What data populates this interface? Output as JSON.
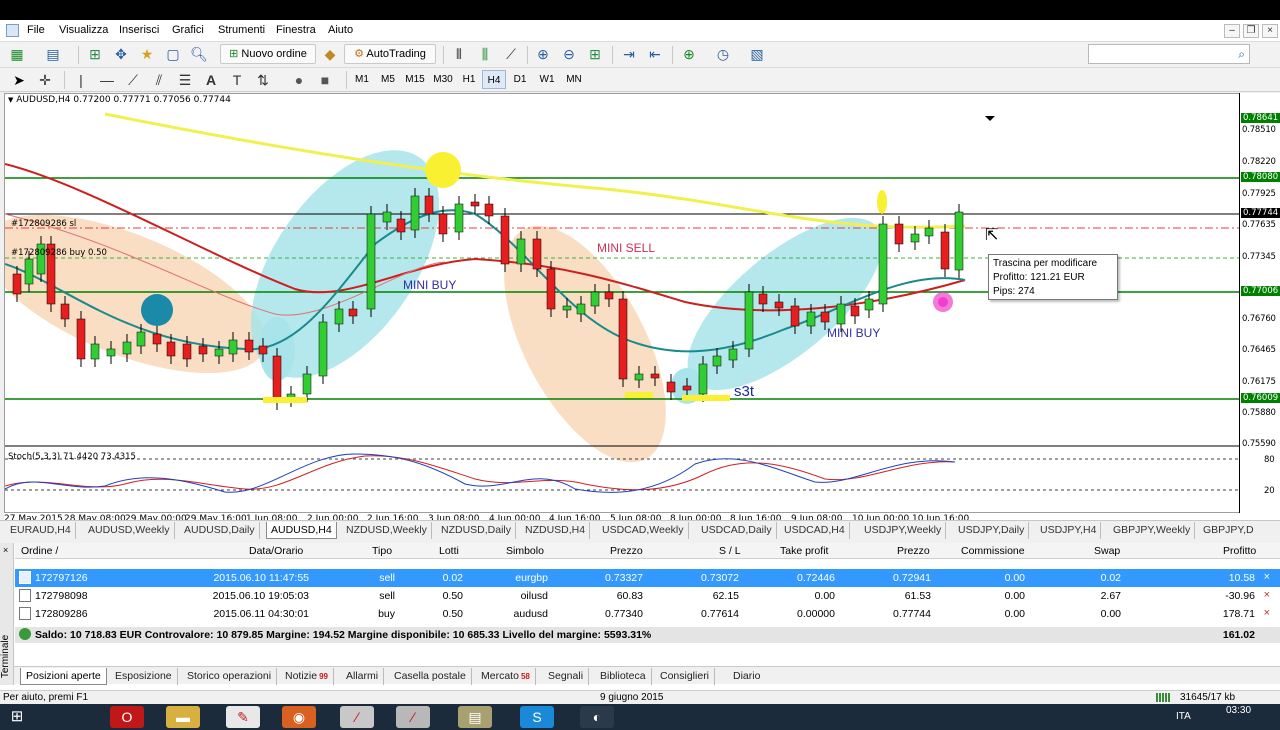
{
  "menu": {
    "items": [
      "File",
      "Visualizza",
      "Inserisci",
      "Grafici",
      "Strumenti",
      "Finestra",
      "Aiuto"
    ]
  },
  "toolbar": {
    "new_order_label": "Nuovo ordine",
    "autotrading_label": "AutoTrading",
    "timeframes": [
      "M1",
      "M5",
      "M15",
      "M30",
      "H1",
      "H4",
      "D1",
      "W1",
      "MN"
    ],
    "active_timeframe": "H4"
  },
  "chart": {
    "header": "AUDUSD,H4  0.77200 0.77771 0.77056 0.77744",
    "symbol": "AUDUSD,H4",
    "ohlc": "0.77200 0.77771 0.77056 0.77744",
    "order_label_sl": "#172809286 sl",
    "order_label_buy": "#172809286 buy 0.50",
    "annotations": {
      "mini_sell": "MINI SELL",
      "mini_buy_1": "MINI BUY",
      "mini_buy_2": "MINI BUY",
      "s3t": "s3t"
    },
    "tooltip": {
      "line1": "Trascina per modificare",
      "line2": "Profitto: 121.21 EUR",
      "line3": "Pips: 274"
    },
    "indicator_label": "Stoch(5,3,3) 71.4420 73.4315",
    "indicator_levels": [
      "80",
      "20"
    ],
    "price_labels": [
      "0.78510",
      "0.78220",
      "0.77925",
      "0.77635",
      "0.77345",
      "0.76760",
      "0.76465",
      "0.76175",
      "0.75880",
      "0.75590"
    ],
    "price_tags": [
      {
        "value": "0.78641",
        "color": "#008000"
      },
      {
        "value": "0.78080",
        "color": "#008000"
      },
      {
        "value": "0.77744",
        "color": "#000000"
      },
      {
        "value": "0.77006",
        "color": "#008000"
      },
      {
        "value": "0.76009",
        "color": "#008000"
      }
    ],
    "time_labels": [
      "27 May 2015",
      "28 May 08:00",
      "29 May 00:00",
      "29 May 16:00",
      "1 Jun 08:00",
      "2 Jun 00:00",
      "2 Jun 16:00",
      "3 Jun 08:00",
      "4 Jun 00:00",
      "4 Jun 16:00",
      "5 Jun 08:00",
      "8 Jun 00:00",
      "8 Jun 16:00",
      "9 Jun 08:00",
      "10 Jun 00:00",
      "10 Jun 16:00"
    ],
    "colors": {
      "bull": "#32cd32",
      "bear": "#e61e1e",
      "ma_yellow": "#f0f050",
      "ma_red": "#cc2020",
      "ma_teal": "#1a8a8a",
      "level_green": "#008000"
    }
  },
  "chart_tabs": [
    "EURAUD,H4",
    "AUDUSD,Weekly",
    "AUDUSD,Daily",
    "AUDUSD,H4",
    "NZDUSD,Weekly",
    "NZDUSD,Daily",
    "NZDUSD,H4",
    "USDCAD,Weekly",
    "USDCAD,Daily",
    "USDCAD,H4",
    "USDJPY,Weekly",
    "USDJPY,Daily",
    "USDJPY,H4",
    "GBPJPY,Weekly",
    "GBPJPY,D"
  ],
  "active_chart_tab": "AUDUSD,H4",
  "terminal": {
    "side_label": "Terminale",
    "columns": [
      "Ordine  /",
      "Data/Orario",
      "Tipo",
      "Lotti",
      "Simbolo",
      "Prezzo",
      "S / L",
      "Take profit",
      "Prezzo",
      "Commissione",
      "Swap",
      "Profitto"
    ],
    "rows": [
      {
        "ordine": "172797126",
        "data": "2015.06.10 11:47:55",
        "tipo": "sell",
        "lotti": "0.02",
        "simbolo": "eurgbp",
        "prezzo": "0.73327",
        "sl": "0.73072",
        "tp": "0.72446",
        "prezzo2": "0.72941",
        "commissione": "0.00",
        "swap": "0.02",
        "profitto": "10.58",
        "selected": true
      },
      {
        "ordine": "172798098",
        "data": "2015.06.10 19:05:03",
        "tipo": "sell",
        "lotti": "0.50",
        "simbolo": "oilusd",
        "prezzo": "60.83",
        "sl": "62.15",
        "tp": "0.00",
        "prezzo2": "61.53",
        "commissione": "0.00",
        "swap": "2.67",
        "profitto": "-30.96",
        "selected": false
      },
      {
        "ordine": "172809286",
        "data": "2015.06.11 04:30:01",
        "tipo": "buy",
        "lotti": "0.50",
        "simbolo": "audusd",
        "prezzo": "0.77340",
        "sl": "0.77614",
        "tp": "0.00000",
        "prezzo2": "0.77744",
        "commissione": "0.00",
        "swap": "0.00",
        "profitto": "178.71",
        "selected": false
      }
    ],
    "summary_text": "Saldo: 10 718.83 EUR  Controvalore: 10 879.85  Margine: 194.52  Margine disponibile: 10 685.33  Livello del margine: 5593.31%",
    "summary_total": "161.02",
    "tabs": [
      {
        "label": "Posizioni aperte",
        "badge": ""
      },
      {
        "label": "Esposizione",
        "badge": ""
      },
      {
        "label": "Storico operazioni",
        "badge": ""
      },
      {
        "label": "Notizie",
        "badge": "99"
      },
      {
        "label": "Allarmi",
        "badge": ""
      },
      {
        "label": "Casella postale",
        "badge": ""
      },
      {
        "label": "Mercato",
        "badge": "58"
      },
      {
        "label": "Segnali",
        "badge": ""
      },
      {
        "label": "Biblioteca",
        "badge": ""
      },
      {
        "label": "Consiglieri",
        "badge": ""
      },
      {
        "label": "Diario",
        "badge": ""
      }
    ]
  },
  "statusbar": {
    "help": "Per aiuto, premi F1",
    "date": "9 giugno 2015",
    "traffic": "31645/17 kb"
  },
  "taskbar": {
    "lang": "ITA",
    "time": "03:30"
  }
}
